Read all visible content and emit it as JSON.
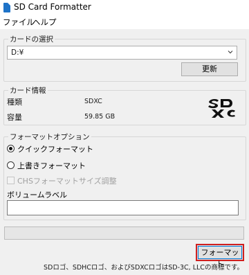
{
  "window": {
    "title": "SD Card Formatter"
  },
  "menu": {
    "file": "ファイル",
    "help": "ヘルプ"
  },
  "card_select": {
    "label": "カードの選択",
    "drive": "D:¥",
    "refresh": "更新"
  },
  "card_info": {
    "label": "カード情報",
    "type_key": "種類",
    "type_val": "SDXC",
    "capacity_key": "容量",
    "capacity_val": "59.85 GB"
  },
  "format_options": {
    "label": "フォーマットオプション",
    "quick": "クイックフォーマット",
    "overwrite": "上書きフォーマット",
    "chs": "CHSフォーマットサイズ調整",
    "volume_label": "ボリュームラベル",
    "volume_value": ""
  },
  "progress": {
    "fraction": 0.0
  },
  "actions": {
    "format": "フォーマット"
  },
  "footer": {
    "note": "SDロゴ、SDHCロゴ、およびSDXCロゴはSD-3C, LLCの商標です。"
  },
  "icons": {
    "app": "sd-card-icon",
    "logo": "sdxc-logo"
  },
  "colors": {
    "highlight": "#cf1f1f",
    "focus": "#0078d7",
    "progress": "#06b025"
  }
}
